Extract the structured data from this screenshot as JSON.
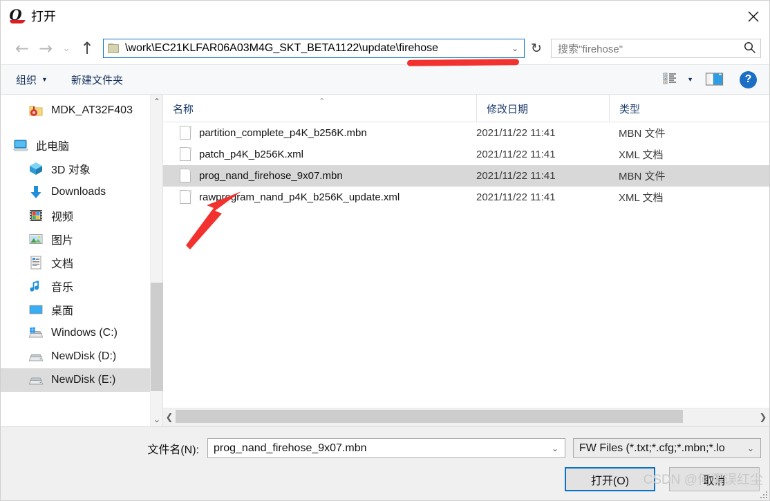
{
  "window": {
    "title": "打开",
    "app_icon": "quectel-q-icon",
    "close_label": "✕"
  },
  "navigation": {
    "back_icon": "arrow-left-icon",
    "forward_icon": "arrow-right-icon",
    "recent_icon": "chevron-down-icon",
    "up_icon": "arrow-up-icon",
    "refresh_icon": "refresh-icon",
    "refresh_glyph": "↻",
    "address": {
      "folder_icon": "folder-icon",
      "path": "\\work\\EC21KLFAR06A03M4G_SKT_BETA1122\\update\\firehose",
      "chevron": "⌄"
    },
    "search": {
      "placeholder": "搜索\"firehose\"",
      "icon": "search-icon"
    }
  },
  "command_bar": {
    "organize_label": "组织",
    "organize_caret": "▼",
    "new_folder_label": "新建文件夹",
    "view_mode_icon": "view-list-icon",
    "view_mode_caret": "▼",
    "preview_pane_icon": "preview-pane-icon",
    "help_icon": "help-icon",
    "help_glyph": "?"
  },
  "sidebar": {
    "items": [
      {
        "label": "MDK_AT32F403",
        "icon": "folder-open-icon",
        "indent": true,
        "selected": false
      },
      {
        "label": "此电脑",
        "icon": "this-pc-icon",
        "indent": false,
        "selected": false
      },
      {
        "label": "3D 对象",
        "icon": "3d-objects-icon",
        "indent": true,
        "selected": false
      },
      {
        "label": "Downloads",
        "icon": "downloads-icon",
        "indent": true,
        "selected": false
      },
      {
        "label": "视频",
        "icon": "videos-icon",
        "indent": true,
        "selected": false
      },
      {
        "label": "图片",
        "icon": "pictures-icon",
        "indent": true,
        "selected": false
      },
      {
        "label": "文档",
        "icon": "documents-icon",
        "indent": true,
        "selected": false
      },
      {
        "label": "音乐",
        "icon": "music-icon",
        "indent": true,
        "selected": false
      },
      {
        "label": "桌面",
        "icon": "desktop-icon",
        "indent": true,
        "selected": false
      },
      {
        "label": "Windows (C:)",
        "icon": "windows-drive-icon",
        "indent": true,
        "selected": false
      },
      {
        "label": "NewDisk (D:)",
        "icon": "drive-icon",
        "indent": true,
        "selected": false
      },
      {
        "label": "NewDisk (E:)",
        "icon": "drive-icon",
        "indent": true,
        "selected": true
      }
    ],
    "scrollbar": {
      "up_arrow": "⌃",
      "down_arrow": "⌄"
    }
  },
  "file_list": {
    "columns": [
      {
        "label": "名称",
        "sorted": true,
        "sort_caret": "⌃"
      },
      {
        "label": "修改日期",
        "sorted": false
      },
      {
        "label": "类型",
        "sorted": false
      }
    ],
    "rows": [
      {
        "name": "partition_complete_p4K_b256K.mbn",
        "date": "2021/11/22 11:41",
        "type": "MBN 文件",
        "selected": false
      },
      {
        "name": "patch_p4K_b256K.xml",
        "date": "2021/11/22 11:41",
        "type": "XML 文档",
        "selected": false
      },
      {
        "name": "prog_nand_firehose_9x07.mbn",
        "date": "2021/11/22 11:41",
        "type": "MBN 文件",
        "selected": true
      },
      {
        "name": "rawprogram_nand_p4K_b256K_update.xml",
        "date": "2021/11/22 11:41",
        "type": "XML 文档",
        "selected": false
      }
    ],
    "hscrollbar": {
      "left_arrow": "❮",
      "right_arrow": "❯"
    }
  },
  "footer": {
    "filename_label": "文件名(N):",
    "filename_value": "prog_nand_firehose_9x07.mbn",
    "filename_chevron": "⌄",
    "filter_value": "FW Files (*.txt;*.cfg;*.mbn;*.lo",
    "filter_chevron": "⌄",
    "open_button": "打开(O)",
    "cancel_button": "取消"
  },
  "annotations": {
    "watermark": "CSDN @何事误红尘",
    "arrow_color": "#f2322f",
    "underline_color": "#f2322f"
  },
  "colors": {
    "accent": "#0a72c8",
    "selection": "#d8d8d8",
    "command_text": "#16325c",
    "help_blue": "#1a6fc4"
  }
}
